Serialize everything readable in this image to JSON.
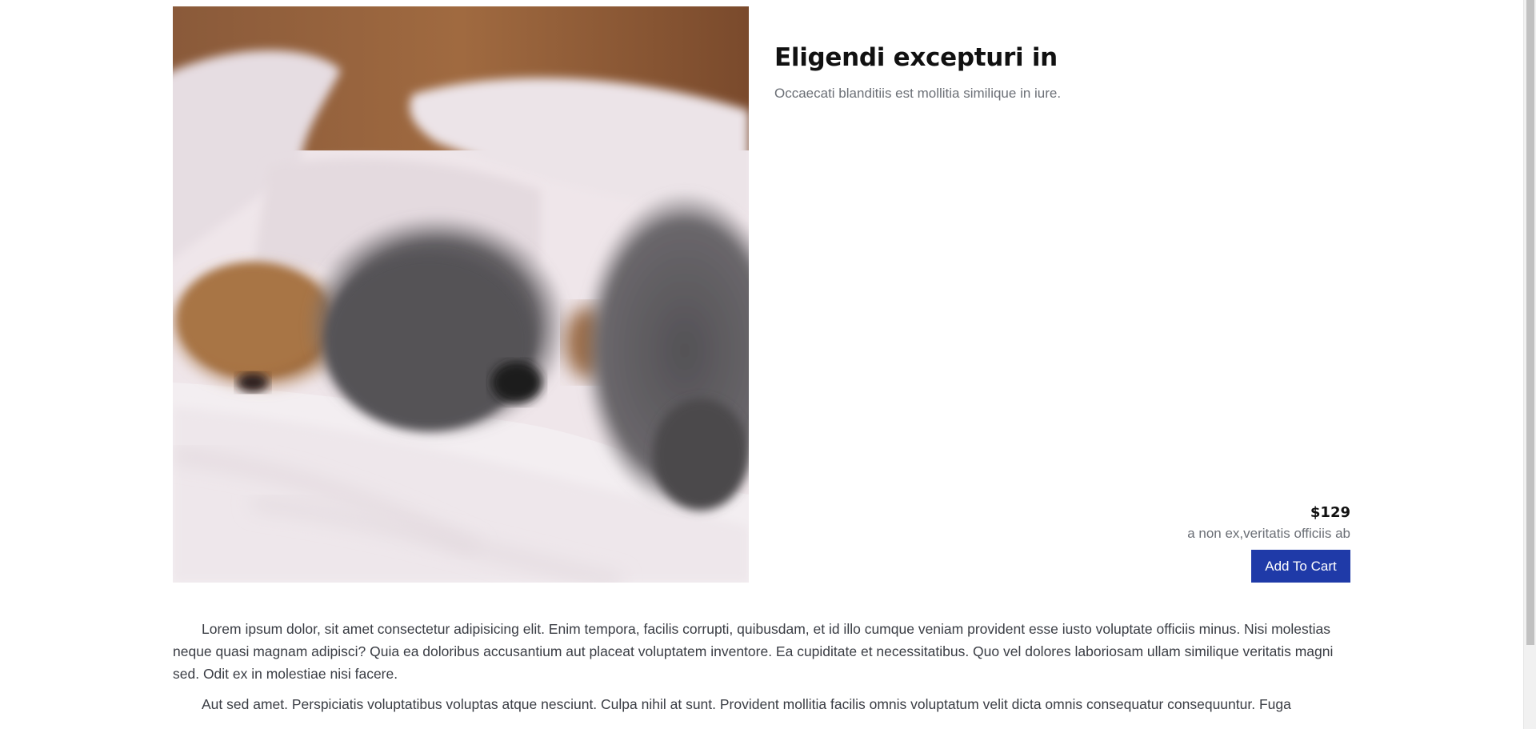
{
  "product": {
    "image_alt": "Two dogs sleeping on a bed",
    "title": "Eligendi excepturi in",
    "subtitle": "Occaecati blanditiis est mollitia similique in iure.",
    "price": "$129",
    "price_note": "a non ex,veritatis officiis ab",
    "add_to_cart_label": "Add To Cart"
  },
  "description": {
    "paragraphs": [
      "Lorem ipsum dolor, sit amet consectetur adipisicing elit. Enim tempora, facilis corrupti, quibusdam, et id illo cumque veniam provident esse iusto voluptate officiis minus. Nisi molestias neque quasi magnam adipisci? Quia ea doloribus accusantium aut placeat voluptatem inventore. Ea cupiditate et necessitatibus. Quo vel dolores laboriosam ullam similique veritatis magni sed. Odit ex in molestiae nisi facere.",
      "Aut sed amet. Perspiciatis voluptatibus voluptas atque nesciunt. Culpa nihil at sunt. Provident mollitia facilis omnis voluptatum velit dicta omnis consequatur consequuntur. Fuga"
    ]
  },
  "colors": {
    "accent": "#1f3aa8",
    "muted_text": "#6b6f76"
  }
}
